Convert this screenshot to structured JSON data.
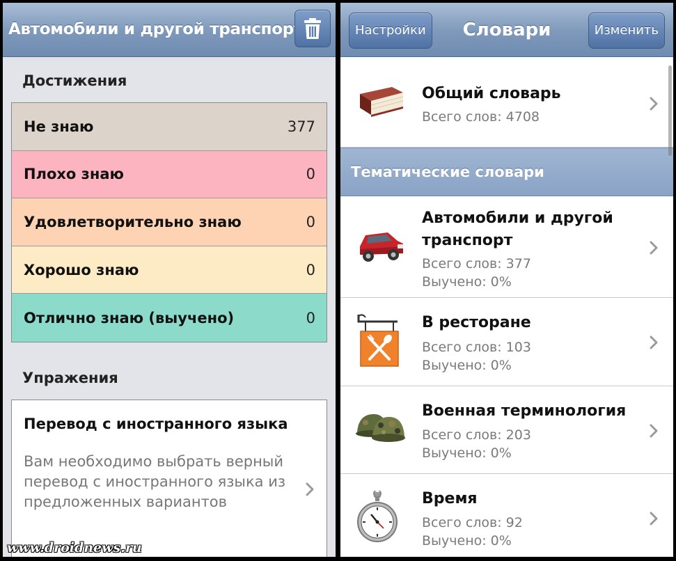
{
  "left": {
    "header": {
      "title": "Автомобили и другой транспорт"
    },
    "achievements": {
      "title": "Достижения",
      "rows": [
        {
          "label": "Не знаю",
          "count": "377",
          "color": "#dcd4ca"
        },
        {
          "label": "Плохо знаю",
          "count": "0",
          "color": "#fbb4c0"
        },
        {
          "label": "Удовлетворительно знаю",
          "count": "0",
          "color": "#fdd3b4"
        },
        {
          "label": "Хорошо знаю",
          "count": "0",
          "color": "#fdebc6"
        },
        {
          "label": "Отлично знаю (выучено)",
          "count": "0",
          "color": "#8cdaca"
        }
      ]
    },
    "exercises": {
      "title": "Упражения",
      "card": {
        "title": "Перевод с иностранного языка",
        "description": "Вам необходимо выбрать верный перевод с иностранного языка из предложенных вариантов"
      }
    },
    "watermark": "www.droidnews.ru"
  },
  "right": {
    "navbar": {
      "settings_label": "Настройки",
      "title": "Словари",
      "edit_label": "Изменить"
    },
    "general": {
      "name": "Общий словарь",
      "total": "Всего слов: 4708"
    },
    "section_title": "Тематические словари",
    "dictionaries": [
      {
        "name": "Автомобили и другой транспорт",
        "total": "Всего слов: 377",
        "learned": "Выучено: 0%",
        "icon": "car-icon"
      },
      {
        "name": "В ресторане",
        "total": "Всего слов: 103",
        "learned": "Выучено: 0%",
        "icon": "restaurant-sign-icon"
      },
      {
        "name": "Военная терминология",
        "total": "Всего слов: 203",
        "learned": "Выучено: 0%",
        "icon": "military-helmet-icon"
      },
      {
        "name": "Время",
        "total": "Всего слов: 92",
        "learned": "Выучено: 0%",
        "icon": "stopwatch-icon"
      }
    ]
  }
}
